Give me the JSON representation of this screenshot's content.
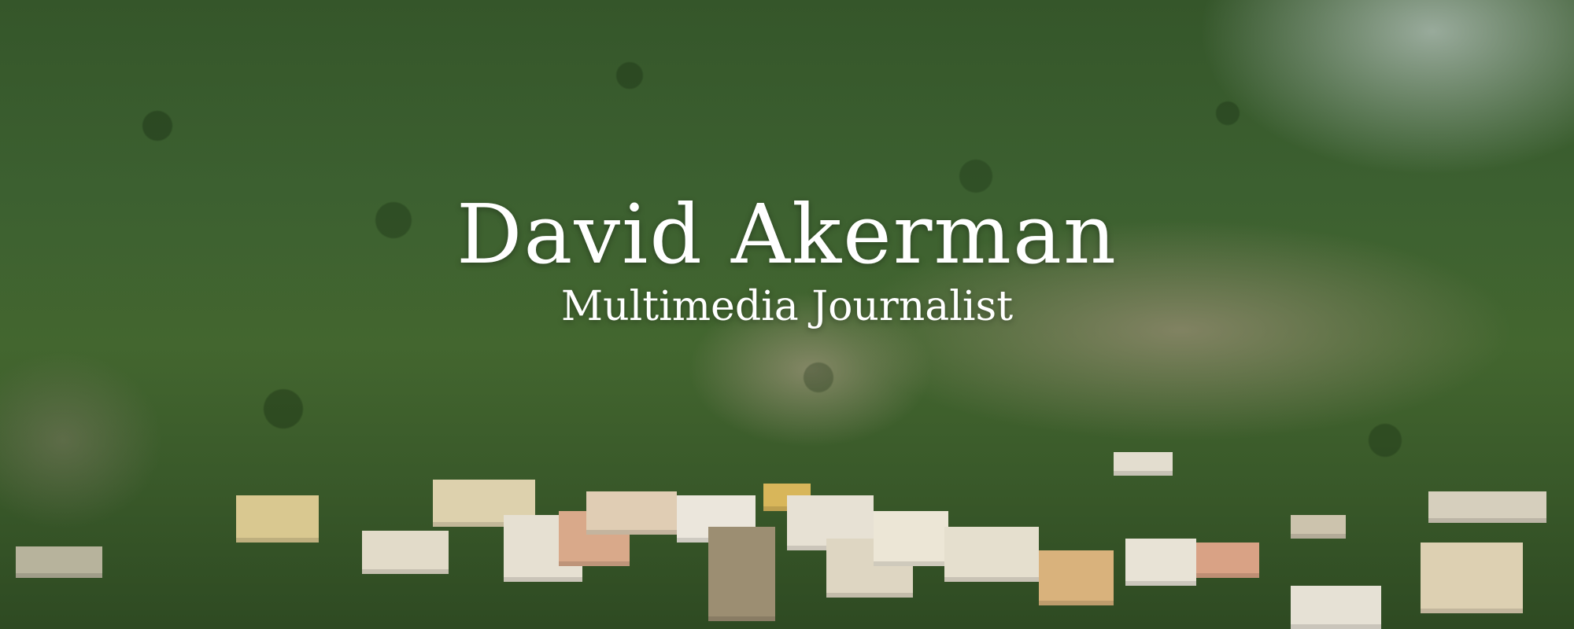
{
  "hero": {
    "name": "David Akerman",
    "subtitle": "Multimedia Journalist"
  },
  "colors": {
    "text": "#ffffff",
    "foliage": "#3c6030",
    "cliff": "#968c73",
    "buildings": "#d8cdb0"
  }
}
